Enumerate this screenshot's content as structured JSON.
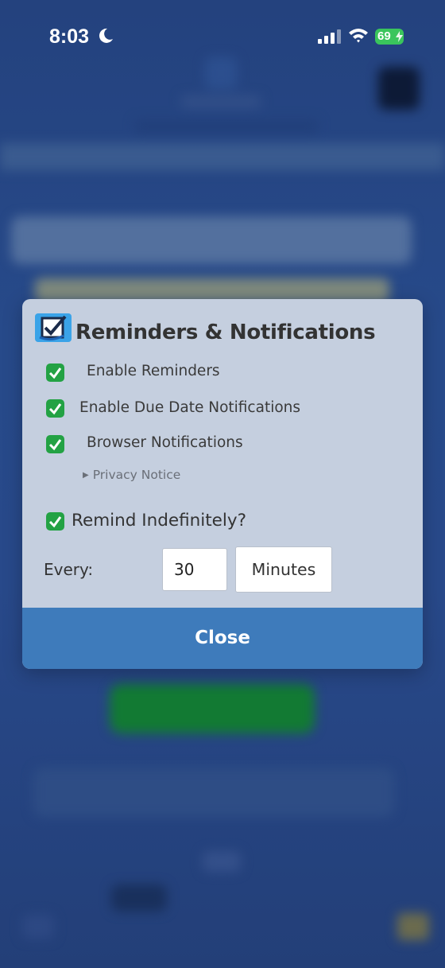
{
  "status_bar": {
    "time": "8:03",
    "battery": "69",
    "icons": [
      "moon-icon",
      "signal-icon",
      "wifi-icon",
      "battery-icon"
    ]
  },
  "modal": {
    "icon": "checkbox-icon",
    "title": "Reminders & Notifications",
    "options": [
      {
        "label": "Enable Reminders",
        "checked": true
      },
      {
        "label": "Enable Due Date Notifications",
        "checked": true
      },
      {
        "label": "Browser Notifications",
        "checked": true
      }
    ],
    "privacy_notice": "Privacy Notice",
    "remind_indefinitely": {
      "label": "Remind Indefinitely?",
      "checked": true
    },
    "interval": {
      "every_label": "Every:",
      "value": "30",
      "unit": "Minutes"
    },
    "close_label": "Close"
  },
  "colors": {
    "check_green": "#23a244",
    "close_blue": "#3e7bbb",
    "modal_bg": "#c5cfdf",
    "page_bg": "#274a8a"
  }
}
